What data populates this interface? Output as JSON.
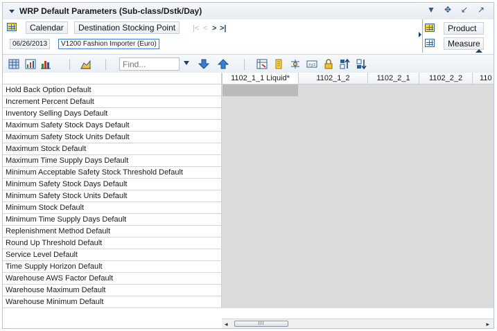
{
  "window": {
    "title": "WRP Default Parameters (Sub-class/Dstk/Day)",
    "controls": [
      "chevron-down-icon",
      "move-icon",
      "minimize-icon",
      "maximize-icon"
    ]
  },
  "dimensions": {
    "left_tiles": [
      "Calendar",
      "Destination Stocking Point"
    ],
    "right_tiles": [
      "Product",
      "Measure"
    ],
    "values": [
      "06/26/2013",
      "V1200 Fashion Importer (Euro)"
    ],
    "nav": [
      "|<",
      "<",
      ">",
      ">|"
    ]
  },
  "toolbar": {
    "find_placeholder": "Find...",
    "icons": [
      "grid-view-icon",
      "chart-table-icon",
      "bar-chart-icon",
      "area-chart-icon",
      "dropdown-icon",
      "down-arrow-icon",
      "up-arrow-icon",
      "swap-icon",
      "note-icon",
      "split-icon",
      "xyz-icon",
      "lock-icon",
      "sort-asc-icon",
      "sort-desc-icon"
    ]
  },
  "grid": {
    "columns": [
      "1102_1_1 Liquid*",
      "1102_1_2",
      "1102_2_1",
      "1102_2_2",
      "110"
    ],
    "rows": [
      "Hold Back Option Default",
      "Increment Percent Default",
      "Inventory Selling Days Default",
      "Maximum Safety Stock Days Default",
      "Maximum Safety Stock Units Default",
      "Maximum Stock Default",
      "Maximum Time Supply Days Default",
      "Minimum Acceptable Safety Stock Threshold Default",
      "Minimum Safety Stock Days Default",
      "Minimum Safety Stock Units Default",
      "Minimum Stock Default",
      "Minimum Time Supply Days Default",
      "Replenishment Method Default",
      "Round Up Threshold Default",
      "Service Level Default",
      "Time Supply Horizon Default",
      "Warehouse AWS Factor Default",
      "Warehouse Maximum Default",
      "Warehouse Minimum Default"
    ]
  },
  "scrollbar": {
    "thumb_label": "III",
    "left_arrow": "◂",
    "right_arrow": "▸"
  },
  "colors": {
    "accent": "#1f3f6b",
    "grid_fill": "#dcdcdc",
    "selected_cell": "#bababa"
  }
}
